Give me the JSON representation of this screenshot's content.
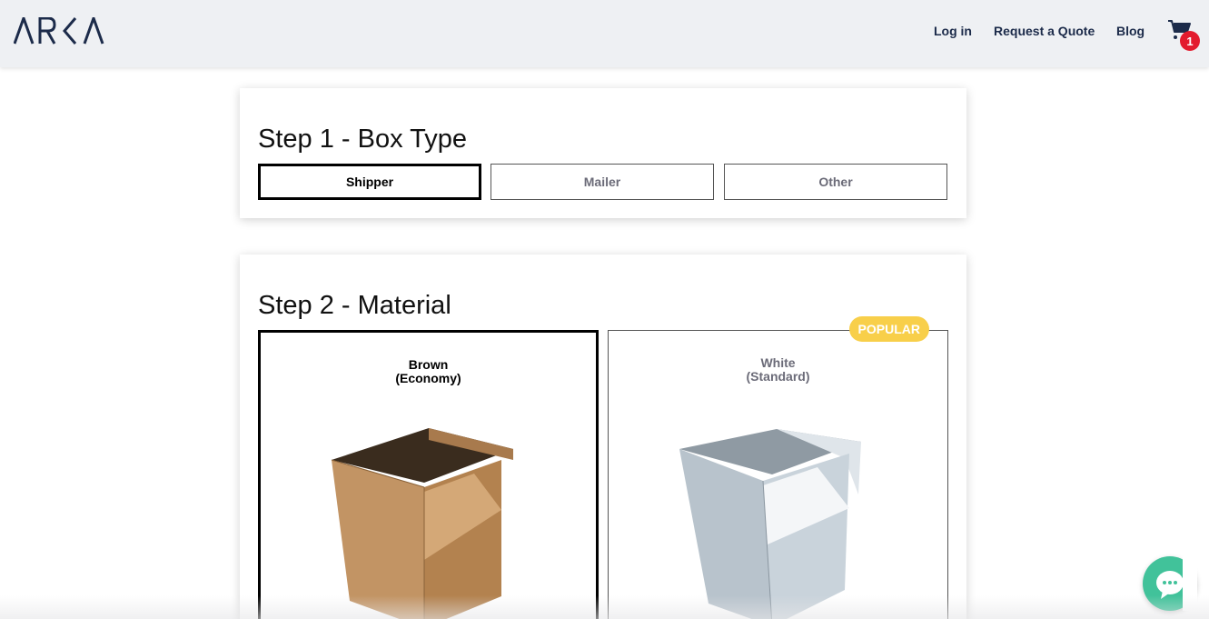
{
  "header": {
    "logo_text": "ARKA",
    "nav": {
      "login": "Log in",
      "quote": "Request a Quote",
      "blog": "Blog"
    },
    "cart": {
      "icon": "cart-icon",
      "count": "1",
      "badge_color": "#e31b2e"
    }
  },
  "step1": {
    "title": "Step 1 - Box Type",
    "options": [
      {
        "label": "Shipper",
        "selected": true
      },
      {
        "label": "Mailer",
        "selected": false
      },
      {
        "label": "Other",
        "selected": false
      }
    ]
  },
  "step2": {
    "title": "Step 2 - Material",
    "options": [
      {
        "name": "Brown",
        "subtitle": "(Economy)",
        "selected": true,
        "badge": ""
      },
      {
        "name": "White",
        "subtitle": "(Standard)",
        "selected": false,
        "badge": "POPULAR"
      }
    ],
    "badge_color": "#f8cf4a"
  },
  "chat": {
    "icon": "chat-bubble-icon",
    "color": "#41c29a"
  }
}
